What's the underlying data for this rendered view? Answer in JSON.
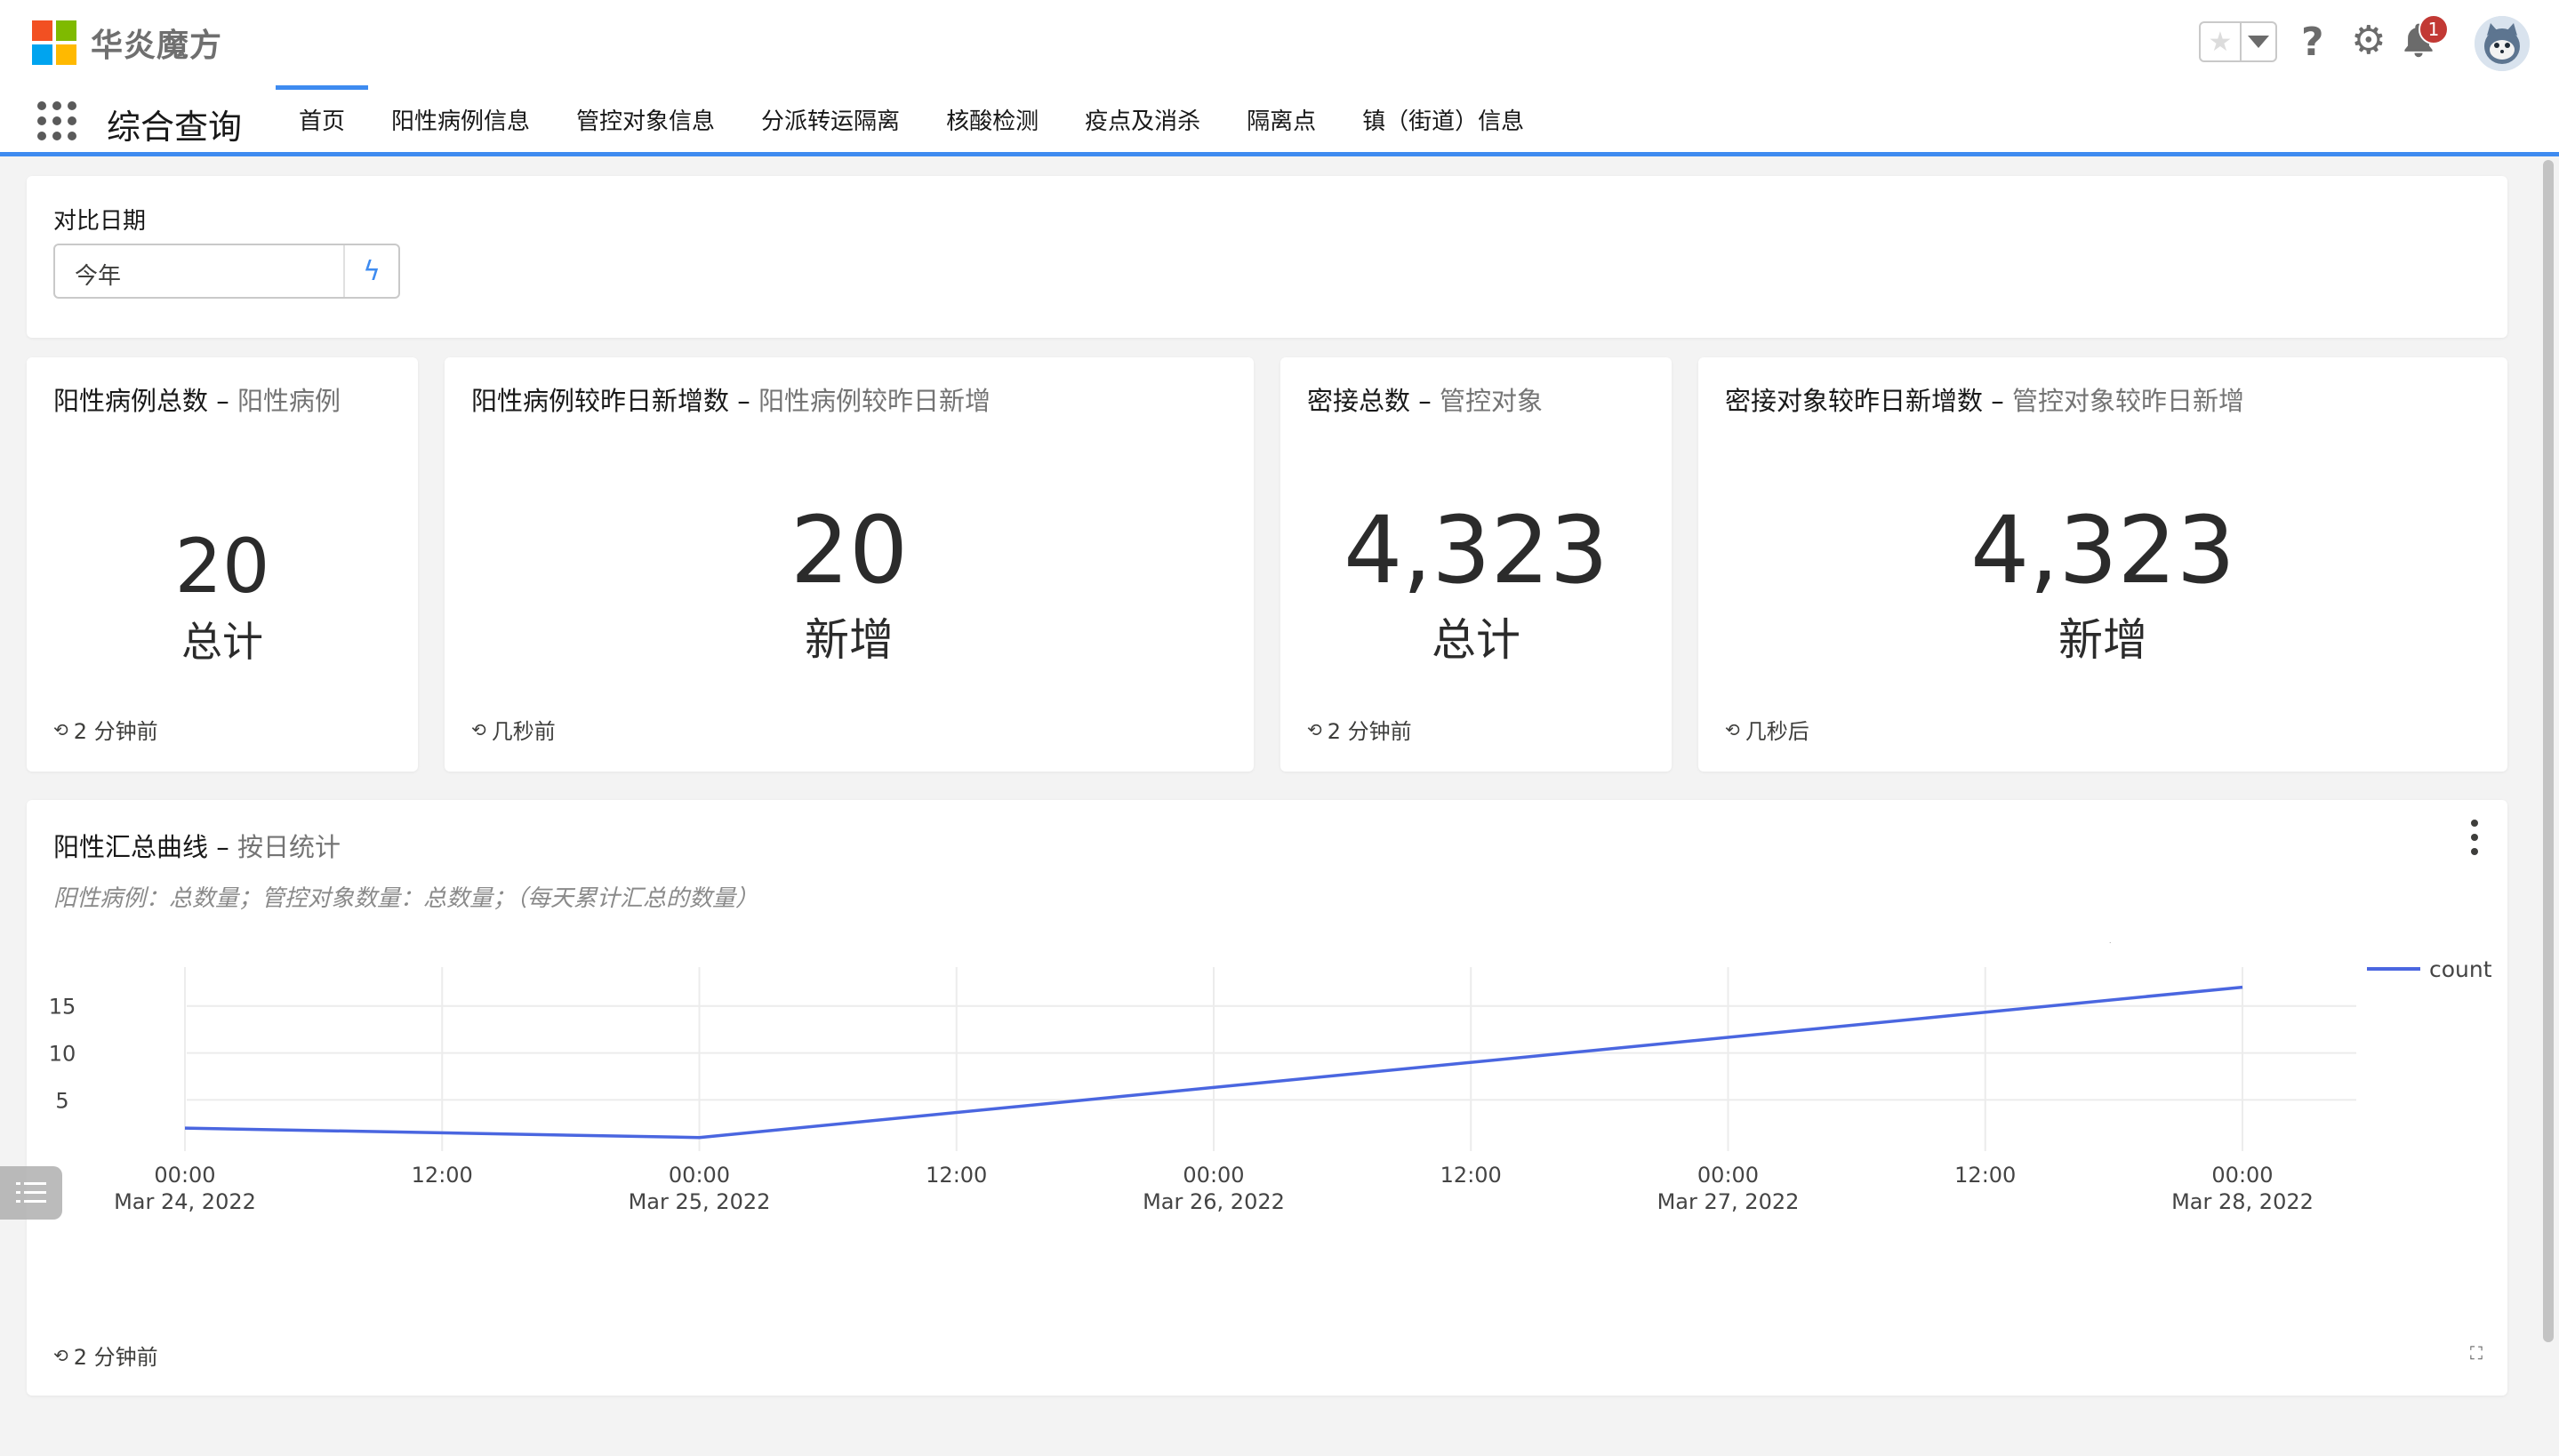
{
  "brand": {
    "name": "华炎魔方",
    "colors": [
      "#f25022",
      "#7fba00",
      "#00a4ef",
      "#ffb900"
    ]
  },
  "header": {
    "app_name": "综合查询",
    "notification_count": "1",
    "icons": [
      "star-icon",
      "chevron-down-icon",
      "help-icon",
      "gear-icon",
      "bell-icon",
      "avatar"
    ]
  },
  "tabs": [
    {
      "label": "首页",
      "active": true
    },
    {
      "label": "阳性病例信息",
      "active": false
    },
    {
      "label": "管控对象信息",
      "active": false
    },
    {
      "label": "分派转运隔离",
      "active": false
    },
    {
      "label": "核酸检测",
      "active": false
    },
    {
      "label": "疫点及消杀",
      "active": false
    },
    {
      "label": "隔离点",
      "active": false
    },
    {
      "label": "镇（街道）信息",
      "active": false
    }
  ],
  "filter": {
    "label": "对比日期",
    "value": "今年"
  },
  "metrics": [
    {
      "title": "阳性病例总数",
      "source": "阳性病例",
      "value": "20",
      "unit": "总计",
      "updated": "2 分钟前"
    },
    {
      "title": "阳性病例较昨日新增数",
      "source": "阳性病例较昨日新增",
      "value": "20",
      "unit": "新增",
      "updated": "几秒前"
    },
    {
      "title": "密接总数",
      "source": "管控对象",
      "value": "4,323",
      "unit": "总计",
      "updated": "2 分钟前"
    },
    {
      "title": "密接对象较昨日新增数",
      "source": "管控对象较昨日新增",
      "value": "4,323",
      "unit": "新增",
      "updated": "几秒后"
    }
  ],
  "chart_card": {
    "title": "阳性汇总曲线",
    "source": "按日统计",
    "description": "阳性病例：总数量；管控对象数量：总数量；（每天累计汇总的数量）",
    "updated": "2 分钟前"
  },
  "chart_data": {
    "type": "line",
    "series": [
      {
        "name": "count",
        "color": "#4a66e0",
        "x": [
          "2022-03-24 00:00",
          "2022-03-25 00:00",
          "2022-03-28 00:00"
        ],
        "y": [
          2,
          1,
          17
        ]
      }
    ],
    "x_ticks": [
      {
        "time": "00:00",
        "date": "Mar 24, 2022"
      },
      {
        "time": "12:00",
        "date": ""
      },
      {
        "time": "00:00",
        "date": "Mar 25, 2022"
      },
      {
        "time": "12:00",
        "date": ""
      },
      {
        "time": "00:00",
        "date": "Mar 26, 2022"
      },
      {
        "time": "12:00",
        "date": ""
      },
      {
        "time": "00:00",
        "date": "Mar 27, 2022"
      },
      {
        "time": "12:00",
        "date": ""
      },
      {
        "time": "00:00",
        "date": "Mar 28, 2022"
      }
    ],
    "y_ticks": [
      "5",
      "10",
      "15"
    ],
    "ylim": [
      0.5,
      18
    ],
    "grid": true,
    "legend": "top-right"
  }
}
